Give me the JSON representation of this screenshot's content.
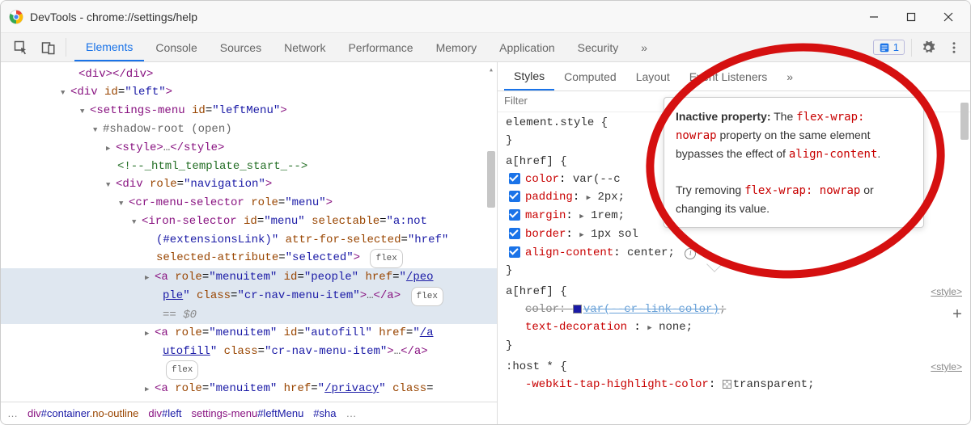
{
  "window": {
    "title": "DevTools - chrome://settings/help"
  },
  "toolbar": {
    "tabs": [
      "Elements",
      "Console",
      "Sources",
      "Network",
      "Performance",
      "Memory",
      "Application",
      "Security"
    ],
    "active_tab": "Elements",
    "issues_count": "1"
  },
  "dom": {
    "l0": "<div></div>",
    "l1_open": "<div id=\"left\">",
    "l2_open": "<settings-menu id=\"leftMenu\">",
    "l3_shadow": "#shadow-root (open)",
    "l4_style": "<style>…</style>",
    "l4_comment": "<!--_html_template_start_-->",
    "l4_nav": "<div role=\"navigation\">",
    "l5_crmenu": "<cr-menu-selector role=\"menu\">",
    "l6_iron_a": "<iron-selector id=\"menu\" selectable=\"a:not",
    "l6_iron_b": "(#extensionsLink)\" attr-for-selected=\"href\"",
    "l6_iron_c": "selected-attribute=\"selected\">",
    "l7_people_a": "<a role=\"menuitem\" id=\"people\" href=\"/peo",
    "l7_people_b": "ple\" class=\"cr-nav-menu-item\">…</a>",
    "l7_people_eq": "== $0",
    "l7_autofill_a": "<a role=\"menuitem\" id=\"autofill\" href=\"/a",
    "l7_autofill_b": "utofill\" class=\"cr-nav-menu-item\">…</a>",
    "l7_privacy": "<a role=\"menuitem\" href=\"/privacy\" class=",
    "flex_badge": "flex"
  },
  "crumbs": {
    "more": "…",
    "c1": "div#container.no-outline",
    "c2": "div#left",
    "c3": "settings-menu#leftMenu",
    "c4": "#sha",
    "more2": "…"
  },
  "styles": {
    "tabs": [
      "Styles",
      "Computed",
      "Layout",
      "Event Listeners"
    ],
    "active_tab": "Styles",
    "filter_placeholder": "Filter",
    "rules": {
      "elstyle": {
        "selector": "element.style",
        "open": "{",
        "close": "}"
      },
      "ahref1": {
        "selector": "a[href]",
        "open": "{",
        "close": "}",
        "props": {
          "color_name": "color",
          "color_val": "var(--c",
          "padding_name": "padding",
          "padding_val": "2px;",
          "margin_name": "margin",
          "margin_val": "1rem;",
          "border_name": "border",
          "border_val": "1px sol",
          "align_name": "align-content",
          "align_val": "center;"
        }
      },
      "ahref2": {
        "selector": "a[href]",
        "open": "{",
        "close": "}",
        "origin": "<style>",
        "props": {
          "color_name": "color",
          "color_val": "var(--cr-link-color)",
          "textdec_name": "text-decoration",
          "textdec_val": "none;"
        }
      },
      "host": {
        "selector": ":host *",
        "open": "{",
        "origin": "<style>",
        "props": {
          "tap_name": "-webkit-tap-highlight-color",
          "tap_val": "transparent;"
        }
      }
    }
  },
  "tooltip": {
    "label": "Inactive property:",
    "text1_a": "The",
    "code1": "flex-wrap: nowrap",
    "text1_b": "property on the same element bypasses the effect of",
    "code2": "align-content",
    "text2_a": "Try removing",
    "code3": "flex-wrap: nowrap",
    "text2_b": "or changing its value."
  }
}
